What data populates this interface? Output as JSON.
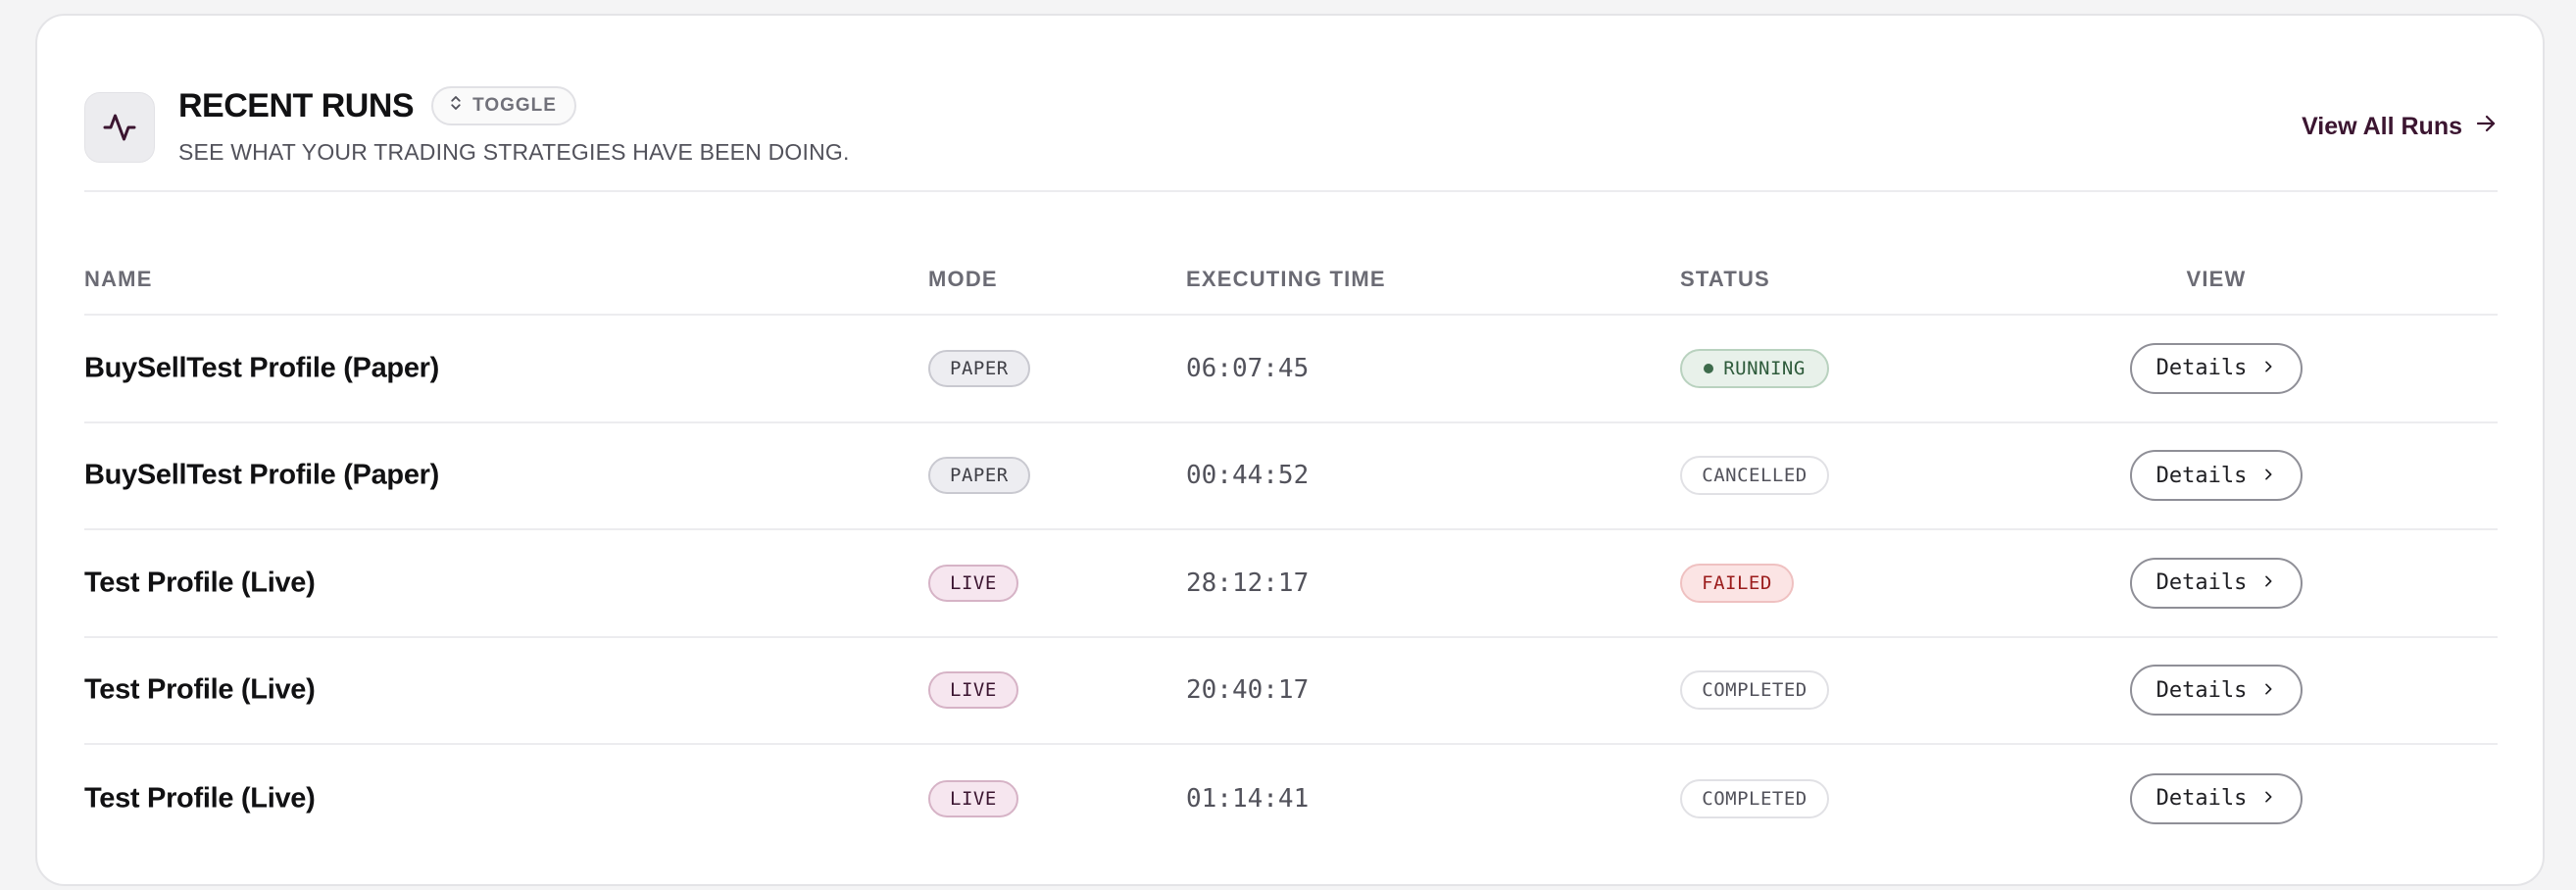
{
  "header": {
    "title": "RECENT RUNS",
    "toggle_label": "TOGGLE",
    "subtitle": "SEE WHAT YOUR TRADING STRATEGIES HAVE BEEN DOING.",
    "view_all_label": "View All Runs"
  },
  "table": {
    "columns": {
      "name": "NAME",
      "mode": "MODE",
      "time": "EXECUTING TIME",
      "status": "STATUS",
      "view": "VIEW"
    },
    "rows": [
      {
        "name": "BuySellTest Profile (Paper)",
        "mode": "PAPER",
        "time": "06:07:45",
        "status": "RUNNING",
        "details": "Details"
      },
      {
        "name": "BuySellTest Profile (Paper)",
        "mode": "PAPER",
        "time": "00:44:52",
        "status": "CANCELLED",
        "details": "Details"
      },
      {
        "name": "Test Profile (Live)",
        "mode": "LIVE",
        "time": "28:12:17",
        "status": "FAILED",
        "details": "Details"
      },
      {
        "name": "Test Profile (Live)",
        "mode": "LIVE",
        "time": "20:40:17",
        "status": "COMPLETED",
        "details": "Details"
      },
      {
        "name": "Test Profile (Live)",
        "mode": "LIVE",
        "time": "01:14:41",
        "status": "COMPLETED",
        "details": "Details"
      }
    ]
  },
  "icons": {
    "header": "activity-pulse-icon",
    "toggle": "chevron-up-down-icon",
    "view_all": "arrow-right-icon",
    "details": "chevron-right-icon"
  },
  "colors": {
    "accent": "#3b1530",
    "running": "#2e5b3b",
    "failed": "#9b1c1c"
  }
}
